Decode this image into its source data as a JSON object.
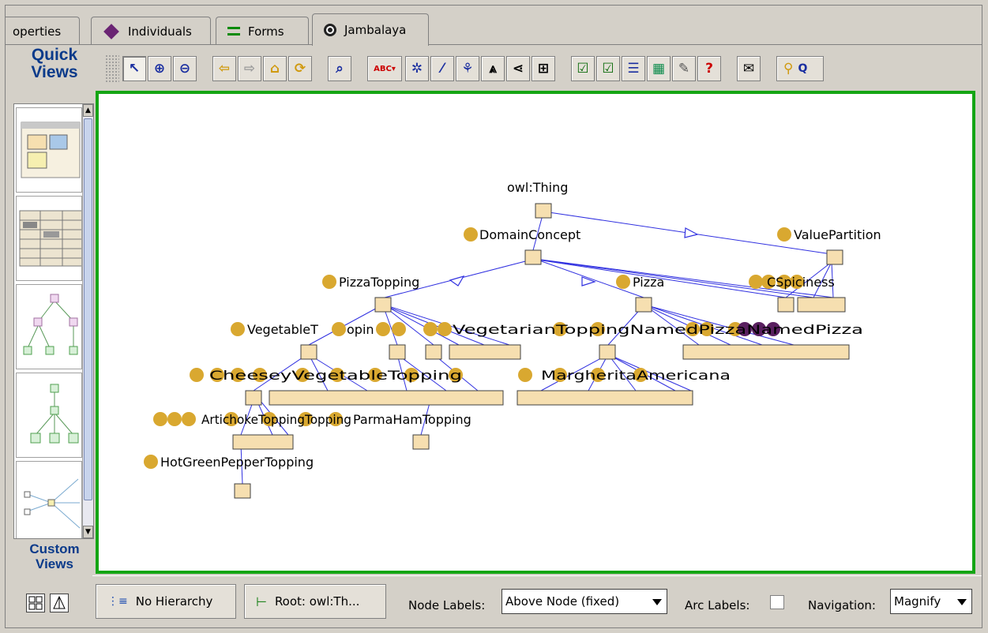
{
  "tabs": [
    {
      "label": "operties",
      "icon": "none"
    },
    {
      "label": "Individuals",
      "icon": "diamond-icon"
    },
    {
      "label": "Forms",
      "icon": "forms-icon"
    },
    {
      "label": "Jambalaya",
      "icon": "eye-icon",
      "active": true
    }
  ],
  "quick_views": {
    "title_line1": "Quick",
    "title_line2": "Views",
    "items": [
      "nested-boxes-view",
      "treemap-view",
      "vertical-tree-view",
      "simple-tree-view",
      "radial-view"
    ]
  },
  "custom_views": {
    "title_line1": "Custom",
    "title_line2": "Views"
  },
  "toolbar": {
    "buttons": [
      "pointer-icon",
      "zoom-in-icon",
      "zoom-out-icon",
      "back-icon",
      "forward-icon",
      "home-icon",
      "refresh-icon",
      "find-icon",
      "label-abc-icon",
      "spring-layout-icon",
      "scatter-layout-icon",
      "tree-layout-icon",
      "vertical-tree-icon",
      "horizontal-tree-icon",
      "grid-layout-icon",
      "filter-icon",
      "filter-arrow-icon",
      "list-icon",
      "film-icon",
      "tool-icon",
      "help-icon",
      "mail-icon",
      "search-icon"
    ],
    "truncated_label": "Q"
  },
  "graph": {
    "labels": {
      "root": "owl:Thing",
      "domain": "DomainConcept",
      "value_partition": "ValuePartition",
      "pizza_topping": "PizzaTopping",
      "pizza": "Pizza",
      "vegetable": "VegetableT",
      "parma": "ParmaHamTopping",
      "hot_green": "HotGreenPepperTopping",
      "overlap_row1_a": "opin",
      "overlap_row1_b": "VegetarianToppingNamedPizzaNamedPizza",
      "overlap_row2_a": "CheeseyVegetableTopping",
      "overlap_row2_b": "MargheritaAmericana",
      "overlap_row3": "ArtichokeToppingTopping",
      "value_children": "CSpiciness"
    }
  },
  "bottom": {
    "no_hierarchy": "No Hierarchy",
    "root": "Root: owl:Th...",
    "node_labels_label": "Node Labels:",
    "node_labels_value": "Above Node (fixed)",
    "arc_labels_label": "Arc Labels:",
    "arc_labels_checked": false,
    "navigation_label": "Navigation:",
    "navigation_value": "Magnify"
  }
}
